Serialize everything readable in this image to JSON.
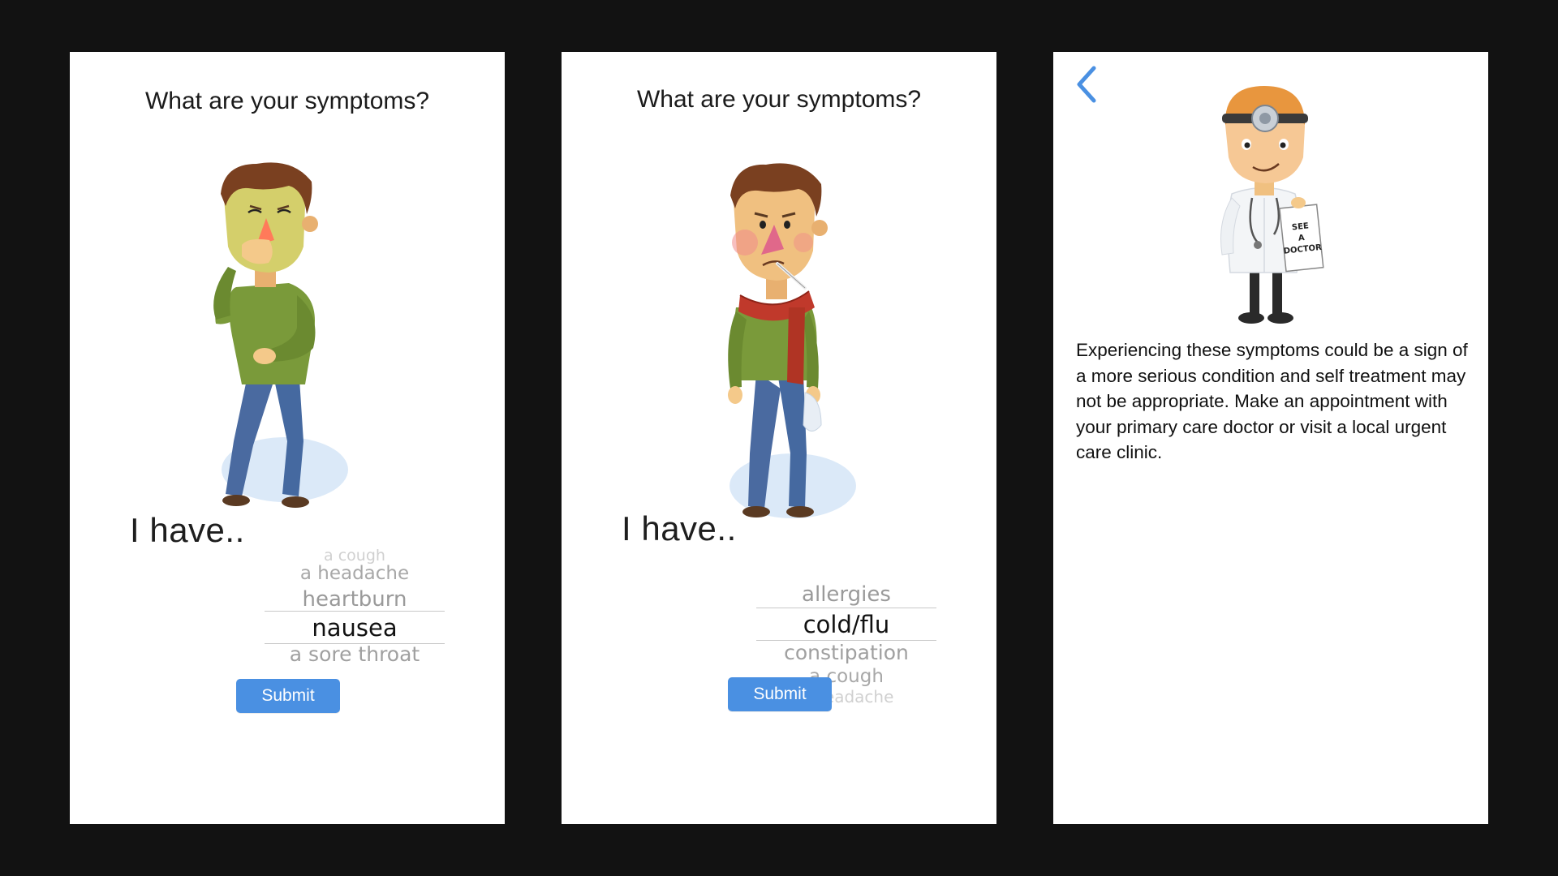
{
  "screen1": {
    "title": "What are your symptoms?",
    "prefix": "I have..",
    "options": [
      "a cough",
      "a headache",
      "heartburn",
      "nausea",
      "a sore throat"
    ],
    "selected": "nausea",
    "submit_label": "Submit"
  },
  "screen2": {
    "title": "What are your symptoms?",
    "prefix": "I have..",
    "options": [
      "allergies",
      "cold/flu",
      "constipation",
      "a cough",
      "a headache"
    ],
    "selected": "cold/flu",
    "submit_label": "Submit"
  },
  "screen3": {
    "back_icon": "chevron-left-icon",
    "doctor_sign": [
      "SEE",
      "A",
      "DOCTOR"
    ],
    "message": "Experiencing these symptoms could be a sign of a more serious condition and self treatment may not be appropriate. Make an appointment with your primary care doctor or visit a local urgent care clinic."
  },
  "colors": {
    "background": "#121212",
    "screen": "#ffffff",
    "accent": "#4a90e2",
    "shirt": "#7a9a3a",
    "jeans": "#4a6aa0",
    "hair": "#7a4020",
    "scarf": "#c0392b"
  }
}
